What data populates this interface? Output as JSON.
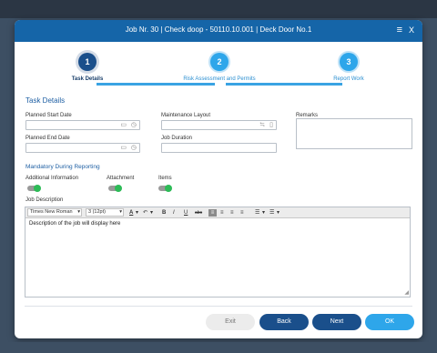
{
  "window": {
    "title": "Job Nr. 30 | Check doop - 50110.10.001 | Deck Door No.1",
    "menu_icon": "≡",
    "close_icon": "X"
  },
  "stepper": {
    "steps": [
      {
        "number": "1",
        "label": "Task Details",
        "state": "active"
      },
      {
        "number": "2",
        "label": "Risk Assessment and Permits",
        "state": "pending"
      },
      {
        "number": "3",
        "label": "Report Work",
        "state": "pending"
      }
    ]
  },
  "task_details": {
    "section_title": "Task Details",
    "planned_start_date_label": "Planned Start Date",
    "planned_start_date_value": "",
    "maintenance_layout_label": "Maintenance Layout",
    "maintenance_layout_value": "",
    "remarks_label": "Remarks",
    "remarks_value": "",
    "planned_end_date_label": "Planned End Date",
    "planned_end_date_value": "",
    "job_duration_label": "Job Duration",
    "job_duration_value": ""
  },
  "reporting": {
    "title": "Mandatory During Reporting",
    "toggles": [
      {
        "label": "Additional Information",
        "on": true
      },
      {
        "label": "Attachment",
        "on": true
      },
      {
        "label": "Items",
        "on": true
      }
    ]
  },
  "job_description": {
    "label": "Job Description",
    "font_family": "Times New Roman",
    "font_size": "3 (12pt)",
    "font_color": "A",
    "bold": "B",
    "italic": "I",
    "underline": "U",
    "strikethrough": "abc",
    "content": "Description of the job will display here"
  },
  "icons": {
    "calendar": "calendar-icon",
    "clock": "clock-icon",
    "menu": "menu-icon",
    "close": "close-icon"
  },
  "buttons": {
    "exit": "Exit",
    "back": "Back",
    "next": "Next",
    "ok": "OK"
  },
  "colors": {
    "header": "#1565a8",
    "primary": "#1a4f8b",
    "accent": "#2ea6ea",
    "toggle_on": "#2dbb57",
    "section_title": "#1e5fa3"
  }
}
